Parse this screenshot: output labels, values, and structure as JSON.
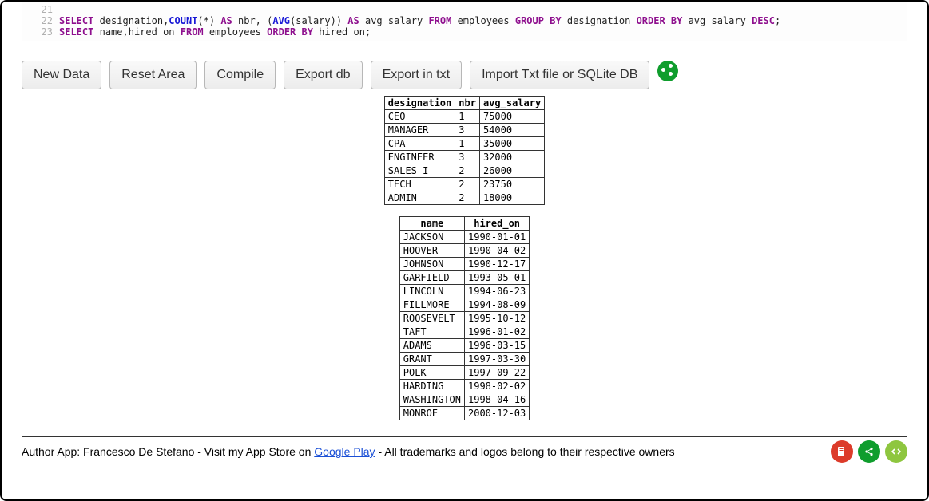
{
  "editor": {
    "lines": [
      {
        "n": 21,
        "html": "<span class='txt'> </span>"
      },
      {
        "n": 22,
        "html": "<span class='kw'>SELECT</span> <span class='txt'>designation,</span><span class='func'>COUNT</span><span class='txt'>(*) </span><span class='kw'>AS</span><span class='txt'> nbr, (</span><span class='func'>AVG</span><span class='txt'>(salary)) </span><span class='kw'>AS</span><span class='txt'> avg_salary </span><span class='kw'>FROM</span><span class='txt'> employees </span><span class='kw'>GROUP BY</span><span class='txt'> designation </span><span class='kw'>ORDER BY</span><span class='txt'> avg_salary </span><span class='kw'>DESC</span><span class='txt'>;</span>"
      },
      {
        "n": 23,
        "html": "<span class='kw'>SELECT</span> <span class='txt'>name,hired_on </span><span class='kw'>FROM</span><span class='txt'> employees </span><span class='kw'>ORDER BY</span><span class='txt'> hired_on;</span>"
      }
    ]
  },
  "buttons": {
    "new_data": "New Data",
    "reset_area": "Reset Area",
    "compile": "Compile",
    "export_db": "Export db",
    "export_txt": "Export in txt",
    "import": "Import Txt file or SQLite DB"
  },
  "table1": {
    "headers": [
      "designation",
      "nbr",
      "avg_salary"
    ],
    "rows": [
      [
        "CEO",
        "1",
        "75000"
      ],
      [
        "MANAGER",
        "3",
        "54000"
      ],
      [
        "CPA",
        "1",
        "35000"
      ],
      [
        "ENGINEER",
        "3",
        "32000"
      ],
      [
        "SALES I",
        "2",
        "26000"
      ],
      [
        "TECH",
        "2",
        "23750"
      ],
      [
        "ADMIN",
        "2",
        "18000"
      ]
    ]
  },
  "table2": {
    "headers": [
      "name",
      "hired_on"
    ],
    "rows": [
      [
        "JACKSON",
        "1990-01-01"
      ],
      [
        "HOOVER",
        "1990-04-02"
      ],
      [
        "JOHNSON",
        "1990-12-17"
      ],
      [
        "GARFIELD",
        "1993-05-01"
      ],
      [
        "LINCOLN",
        "1994-06-23"
      ],
      [
        "FILLMORE",
        "1994-08-09"
      ],
      [
        "ROOSEVELT",
        "1995-10-12"
      ],
      [
        "TAFT",
        "1996-01-02"
      ],
      [
        "ADAMS",
        "1996-03-15"
      ],
      [
        "GRANT",
        "1997-03-30"
      ],
      [
        "POLK",
        "1997-09-22"
      ],
      [
        "HARDING",
        "1998-02-02"
      ],
      [
        "WASHINGTON",
        "1998-04-16"
      ],
      [
        "MONROE",
        "2000-12-03"
      ]
    ]
  },
  "footer": {
    "prefix": "Author App: Francesco De Stefano - Visit my App Store on ",
    "link": "Google Play",
    "suffix": " - All trademarks and logos belong to their respective owners"
  },
  "chart_data": [
    {
      "type": "table",
      "title": "avg_salary by designation",
      "columns": [
        "designation",
        "nbr",
        "avg_salary"
      ],
      "rows": [
        [
          "CEO",
          1,
          75000
        ],
        [
          "MANAGER",
          3,
          54000
        ],
        [
          "CPA",
          1,
          35000
        ],
        [
          "ENGINEER",
          3,
          32000
        ],
        [
          "SALES I",
          2,
          26000
        ],
        [
          "TECH",
          2,
          23750
        ],
        [
          "ADMIN",
          2,
          18000
        ]
      ]
    },
    {
      "type": "table",
      "title": "employees by hired_on",
      "columns": [
        "name",
        "hired_on"
      ],
      "rows": [
        [
          "JACKSON",
          "1990-01-01"
        ],
        [
          "HOOVER",
          "1990-04-02"
        ],
        [
          "JOHNSON",
          "1990-12-17"
        ],
        [
          "GARFIELD",
          "1993-05-01"
        ],
        [
          "LINCOLN",
          "1994-06-23"
        ],
        [
          "FILLMORE",
          "1994-08-09"
        ],
        [
          "ROOSEVELT",
          "1995-10-12"
        ],
        [
          "TAFT",
          "1996-01-02"
        ],
        [
          "ADAMS",
          "1996-03-15"
        ],
        [
          "GRANT",
          "1997-03-30"
        ],
        [
          "POLK",
          "1997-09-22"
        ],
        [
          "HARDING",
          "1998-02-02"
        ],
        [
          "WASHINGTON",
          "1998-04-16"
        ],
        [
          "MONROE",
          "2000-12-03"
        ]
      ]
    }
  ]
}
